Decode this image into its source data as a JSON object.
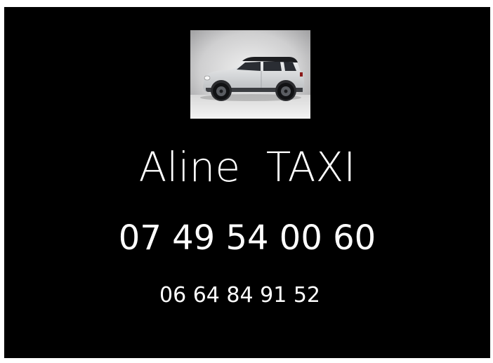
{
  "business": {
    "name": "Aline  TAXI",
    "phone_primary": "07 49 54 00 60",
    "phone_secondary": "06 64 84 91 52"
  },
  "photo": {
    "icon": "car-photo-icon",
    "car_body_color": "#d9dbdd",
    "car_roof_color": "#1c1d20",
    "backdrop_color": "#c8c8c8"
  },
  "colors": {
    "background": "#000000",
    "text": "#ffffff"
  }
}
